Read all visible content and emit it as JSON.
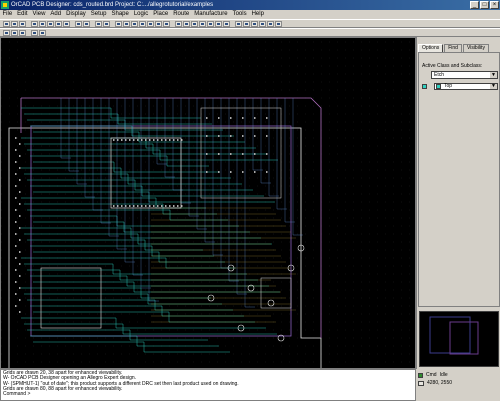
{
  "window": {
    "title": "OrCAD PCB Designer: cds_routed.brd  Project: C:.../allegrotutorial/examples",
    "controls": {
      "minimize": "_",
      "maximize": "□",
      "close": "×"
    }
  },
  "menu": [
    "File",
    "Edit",
    "View",
    "Add",
    "Display",
    "Setup",
    "Shape",
    "Logic",
    "Place",
    "Route",
    "Manufacture",
    "Tools",
    "Help"
  ],
  "panel": {
    "tabs": [
      "Options",
      "Find",
      "Visibility"
    ],
    "active_tab": "Options",
    "active_label": "Active Class and Subclass:",
    "class_value": "Etch",
    "subclass_value": "Top",
    "colors": {
      "swatch1": "#30d0c0",
      "swatch2": "#30d0c0"
    }
  },
  "console": {
    "lines": [
      "Grids are drawn 20, 38 apart for enhanced viewability.",
      "W- OrCAD PCB Designer opening an Allegro Expert design.",
      "W- (SPMHUT-1) \"out of date\"; this product supports a different DRC set then last product used on drawing.",
      "Grids are drawn 80, 88 apart for enhanced viewability."
    ],
    "prompt": "Command >"
  },
  "status": {
    "mode": "Cmd",
    "state": "Idle",
    "coordinates": "4280, 2550"
  },
  "board_colors": {
    "etch_top": "#2bd7c8",
    "outline": "#e8e8e8",
    "grid": "#3a3a3a",
    "pads": "#e0e0e0"
  }
}
